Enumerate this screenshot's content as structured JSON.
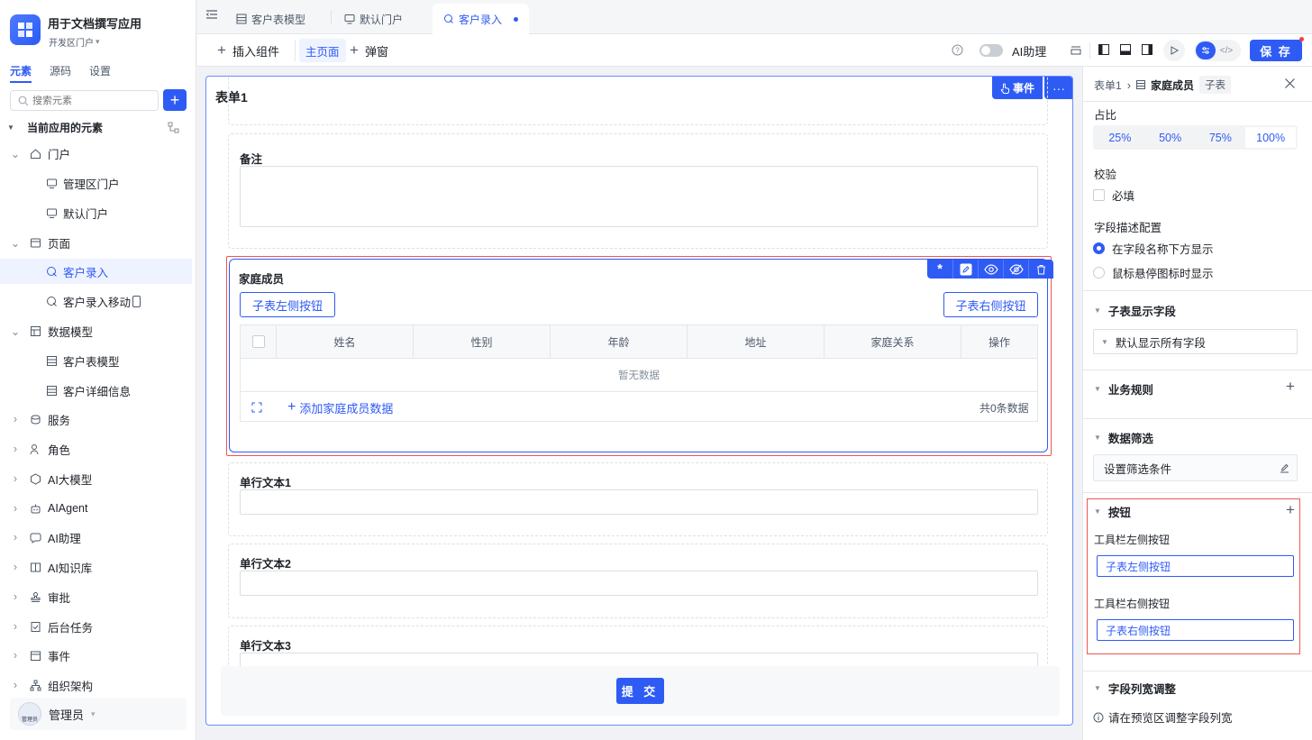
{
  "app": {
    "name": "用于文档撰写应用",
    "portal": "开发区门户"
  },
  "left_tabs": [
    "元素",
    "源码",
    "设置"
  ],
  "search": {
    "placeholder": "搜索元素"
  },
  "tree": {
    "section": "当前应用的元素",
    "items": [
      "门户",
      "管理区门户",
      "默认门户",
      "页面",
      "客户录入",
      "客户录入移动",
      "数据模型",
      "客户表模型",
      "客户详细信息",
      "服务",
      "角色",
      "AI大模型",
      "AIAgent",
      "AI助理",
      "AI知识库",
      "审批",
      "后台任务",
      "事件",
      "组织架构"
    ]
  },
  "user": {
    "name": "管理员",
    "avatar_text": "管理员"
  },
  "tabs": [
    "客户表模型",
    "默认门户",
    "客户录入"
  ],
  "toolbar": {
    "insert": "插入组件",
    "main_page": "主页面",
    "popup": "弹窗",
    "ai_assistant": "AI助理",
    "save": "保 存"
  },
  "form": {
    "title": "表单1",
    "event": "事件",
    "fields": {
      "remark": "备注",
      "text1": "单行文本1",
      "text2": "单行文本2",
      "text3": "单行文本3"
    },
    "subtable": {
      "title": "家庭成员",
      "left_btn": "子表左侧按钮",
      "right_btn": "子表右侧按钮",
      "columns": [
        "姓名",
        "性别",
        "年龄",
        "地址",
        "家庭关系",
        "操作"
      ],
      "empty": "暂无数据",
      "add": "添加家庭成员数据",
      "total": "共0条数据"
    },
    "submit": "提 交"
  },
  "panel": {
    "breadcrumb": {
      "parent": "表单1",
      "current": "家庭成员",
      "tag": "子表"
    },
    "ratio": {
      "label": "占比",
      "options": [
        "25%",
        "50%",
        "75%",
        "100%"
      ],
      "selected": "100%"
    },
    "validate": {
      "label": "校验",
      "required": "必填"
    },
    "desc": {
      "label": "字段描述配置",
      "opt1": "在字段名称下方显示",
      "opt2": "鼠标悬停图标时显示"
    },
    "display_fields": {
      "label": "子表显示字段",
      "value": "默认显示所有字段"
    },
    "rules": "业务规则",
    "filter": {
      "label": "数据筛选",
      "value": "设置筛选条件"
    },
    "buttons": {
      "label": "按钮",
      "left_label": "工具栏左侧按钮",
      "left_value": "子表左侧按钮",
      "right_label": "工具栏右侧按钮",
      "right_value": "子表右侧按钮"
    },
    "col_width": {
      "label": "字段列宽调整",
      "hint": "请在预览区调整字段列宽"
    }
  },
  "colors": {
    "accent": "#2f5bf5",
    "highlight": "#f05555"
  }
}
